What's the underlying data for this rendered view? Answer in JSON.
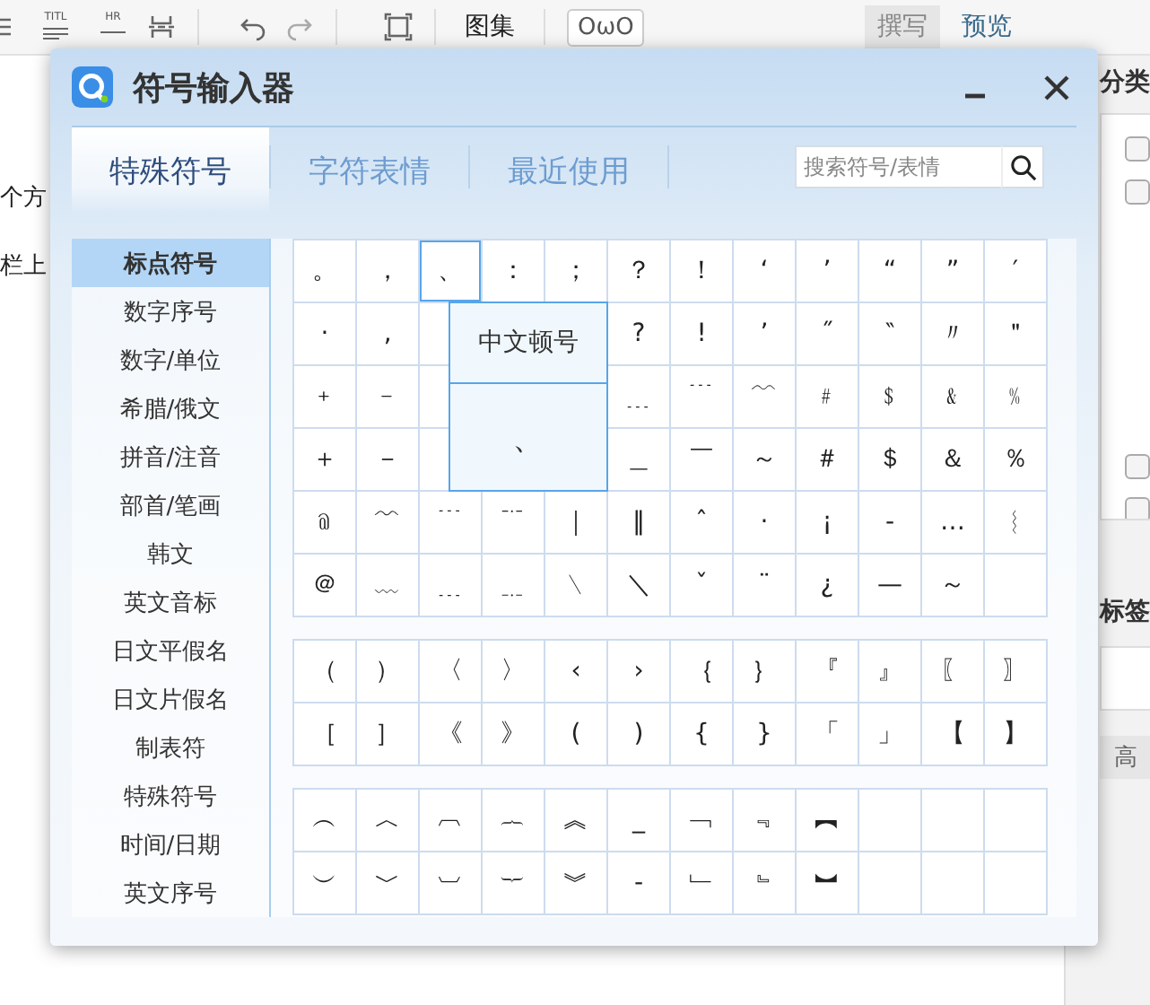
{
  "toolbar": {
    "title_button": "TITL",
    "hr_button": "HR",
    "gallery_button": "图集",
    "emoji_button": "OωO",
    "modes": [
      {
        "label": "撰写",
        "selected": true
      },
      {
        "label": "预览",
        "selected": false
      }
    ]
  },
  "editor": {
    "lines": [
      "个方",
      "栏上"
    ]
  },
  "side_panel": {
    "category_heading": "分类",
    "categories": [
      {
        "checked": false
      },
      {
        "checked": false
      },
      {
        "checked": false
      },
      {
        "checked": false
      }
    ],
    "tags_heading": "标签",
    "advanced": "高"
  },
  "dialog": {
    "title": "符号输入器",
    "tabs": [
      {
        "label": "特殊符号",
        "selected": true
      },
      {
        "label": "字符表情",
        "selected": false
      },
      {
        "label": "最近使用",
        "selected": false
      }
    ],
    "search": {
      "placeholder": "搜索符号/表情"
    },
    "categories": [
      {
        "label": "标点符号",
        "selected": true
      },
      {
        "label": "数字序号",
        "selected": false
      },
      {
        "label": "数字/单位",
        "selected": false
      },
      {
        "label": "希腊/俄文",
        "selected": false
      },
      {
        "label": "拼音/注音",
        "selected": false
      },
      {
        "label": "部首/笔画",
        "selected": false
      },
      {
        "label": "韩文",
        "selected": false
      },
      {
        "label": "英文音标",
        "selected": false
      },
      {
        "label": "日文平假名",
        "selected": false
      },
      {
        "label": "日文片假名",
        "selected": false
      },
      {
        "label": "制表符",
        "selected": false
      },
      {
        "label": "特殊符号",
        "selected": false
      },
      {
        "label": "时间/日期",
        "selected": false
      },
      {
        "label": "英文序号",
        "selected": false
      }
    ],
    "sections": [
      {
        "rows": [
          [
            {
              "kind": "symbol",
              "symbol": "。",
              "selected": false
            },
            {
              "kind": "symbol",
              "symbol": "，",
              "selected": false
            },
            {
              "kind": "symbol",
              "symbol": "、",
              "selected": true
            },
            {
              "kind": "symbol",
              "symbol": "：",
              "selected": false
            },
            {
              "kind": "symbol",
              "symbol": "；",
              "selected": false
            },
            {
              "kind": "symbol",
              "symbol": "？",
              "selected": false
            },
            {
              "kind": "symbol",
              "symbol": "！",
              "selected": false
            },
            {
              "kind": "symbol",
              "symbol": "‘",
              "selected": false
            },
            {
              "kind": "symbol",
              "symbol": "’",
              "selected": false
            },
            {
              "kind": "symbol",
              "symbol": "“",
              "selected": false
            },
            {
              "kind": "symbol",
              "symbol": "”",
              "selected": false
            },
            {
              "kind": "symbol",
              "symbol": "′",
              "selected": false
            }
          ],
          [
            {
              "kind": "symbol",
              "symbol": "·",
              "selected": false
            },
            {
              "kind": "symbol",
              "symbol": "‚",
              "selected": false
            },
            null,
            null,
            null,
            {
              "kind": "symbol",
              "symbol": "?",
              "selected": false
            },
            {
              "kind": "symbol",
              "symbol": "!",
              "selected": false
            },
            {
              "kind": "symbol",
              "symbol": "ʼ",
              "selected": false
            },
            {
              "kind": "symbol",
              "symbol": "˝",
              "selected": false
            },
            {
              "kind": "symbol",
              "symbol": "‶",
              "selected": false
            },
            {
              "kind": "symbol",
              "symbol": "〃",
              "selected": false
            },
            {
              "kind": "symbol",
              "symbol": "＂",
              "selected": false
            }
          ],
          [
            {
              "kind": "symbol",
              "symbol": "﹢",
              "selected": false
            },
            {
              "kind": "symbol",
              "symbol": "﹣",
              "selected": false
            },
            null,
            null,
            null,
            {
              "kind": "symbol",
              "symbol": "﹍",
              "selected": false
            },
            {
              "kind": "symbol",
              "symbol": "﹉",
              "selected": false
            },
            {
              "kind": "symbol",
              "symbol": "﹋",
              "selected": false
            },
            {
              "kind": "symbol",
              "symbol": "﹟",
              "selected": false
            },
            {
              "kind": "symbol",
              "symbol": "﹩",
              "selected": false
            },
            {
              "kind": "symbol",
              "symbol": "﹠",
              "selected": false
            },
            {
              "kind": "symbol",
              "symbol": "﹪",
              "selected": false
            }
          ],
          [
            {
              "kind": "symbol",
              "symbol": "＋",
              "selected": false
            },
            {
              "kind": "symbol",
              "symbol": "－",
              "selected": false
            },
            null,
            null,
            null,
            {
              "kind": "symbol",
              "symbol": "＿",
              "selected": false
            },
            {
              "kind": "symbol",
              "symbol": "￣",
              "selected": false
            },
            {
              "kind": "symbol",
              "symbol": "～",
              "selected": false
            },
            {
              "kind": "symbol",
              "symbol": "＃",
              "selected": false
            },
            {
              "kind": "symbol",
              "symbol": "＄",
              "selected": false
            },
            {
              "kind": "symbol",
              "symbol": "＆",
              "selected": false
            },
            {
              "kind": "symbol",
              "symbol": "％",
              "selected": false
            }
          ],
          [
            {
              "kind": "symbol",
              "symbol": "﹫",
              "selected": false
            },
            {
              "kind": "symbol",
              "symbol": "﹌",
              "selected": false
            },
            {
              "kind": "symbol",
              "symbol": "﹉",
              "selected": false
            },
            {
              "kind": "symbol",
              "symbol": "﹊",
              "selected": false
            },
            {
              "kind": "symbol",
              "symbol": "｜",
              "selected": false
            },
            {
              "kind": "symbol",
              "symbol": "‖",
              "selected": false
            },
            {
              "kind": "symbol",
              "symbol": "ˆ",
              "selected": false
            },
            {
              "kind": "symbol",
              "symbol": "·",
              "selected": false
            },
            {
              "kind": "symbol",
              "symbol": "¡",
              "selected": false
            },
            {
              "kind": "symbol",
              "symbol": "‐",
              "selected": false
            },
            {
              "kind": "symbol",
              "symbol": "…",
              "selected": false
            },
            {
              "kind": "symbol",
              "symbol": "︴",
              "selected": false
            }
          ],
          [
            {
              "kind": "symbol",
              "symbol": "＠",
              "selected": false
            },
            {
              "kind": "symbol",
              "symbol": "﹏",
              "selected": false
            },
            {
              "kind": "symbol",
              "symbol": "﹍",
              "selected": false
            },
            {
              "kind": "symbol",
              "symbol": "﹎",
              "selected": false
            },
            {
              "kind": "symbol",
              "symbol": "﹨",
              "selected": false
            },
            {
              "kind": "symbol",
              "symbol": "＼",
              "selected": false
            },
            {
              "kind": "symbol",
              "symbol": "ˇ",
              "selected": false
            },
            {
              "kind": "symbol",
              "symbol": "¨",
              "selected": false
            },
            {
              "kind": "symbol",
              "symbol": "¿",
              "selected": false
            },
            {
              "kind": "symbol",
              "symbol": "—",
              "selected": false
            },
            {
              "kind": "symbol",
              "symbol": "～",
              "selected": false
            },
            {
              "kind": "empty"
            }
          ]
        ]
      },
      {
        "rows": [
          [
            {
              "kind": "symbol",
              "symbol": "（",
              "selected": false
            },
            {
              "kind": "symbol",
              "symbol": "）",
              "selected": false
            },
            {
              "kind": "symbol",
              "symbol": "〈",
              "selected": false
            },
            {
              "kind": "symbol",
              "symbol": "〉",
              "selected": false
            },
            {
              "kind": "symbol",
              "symbol": "‹",
              "selected": false
            },
            {
              "kind": "symbol",
              "symbol": "›",
              "selected": false
            },
            {
              "kind": "symbol",
              "symbol": "｛",
              "selected": false
            },
            {
              "kind": "symbol",
              "symbol": "｝",
              "selected": false
            },
            {
              "kind": "symbol",
              "symbol": "『",
              "selected": false
            },
            {
              "kind": "symbol",
              "symbol": "』",
              "selected": false
            },
            {
              "kind": "symbol",
              "symbol": "〖",
              "selected": false
            },
            {
              "kind": "symbol",
              "symbol": "〗",
              "selected": false
            }
          ],
          [
            {
              "kind": "symbol",
              "symbol": "［",
              "selected": false
            },
            {
              "kind": "symbol",
              "symbol": "］",
              "selected": false
            },
            {
              "kind": "symbol",
              "symbol": "《",
              "selected": false
            },
            {
              "kind": "symbol",
              "symbol": "》",
              "selected": false
            },
            {
              "kind": "symbol",
              "symbol": "(",
              "selected": false
            },
            {
              "kind": "symbol",
              "symbol": ")",
              "selected": false
            },
            {
              "kind": "symbol",
              "symbol": "{",
              "selected": false
            },
            {
              "kind": "symbol",
              "symbol": "}",
              "selected": false
            },
            {
              "kind": "symbol",
              "symbol": "「",
              "selected": false
            },
            {
              "kind": "symbol",
              "symbol": "」",
              "selected": false
            },
            {
              "kind": "symbol",
              "symbol": "【",
              "selected": false
            },
            {
              "kind": "symbol",
              "symbol": "】",
              "selected": false
            }
          ]
        ]
      },
      {
        "rows": [
          [
            {
              "kind": "symbol",
              "symbol": "︵",
              "selected": false
            },
            {
              "kind": "symbol",
              "symbol": "︿",
              "selected": false
            },
            {
              "kind": "symbol",
              "symbol": "︹",
              "selected": false
            },
            {
              "kind": "symbol",
              "symbol": "︷",
              "selected": false
            },
            {
              "kind": "symbol",
              "symbol": "︽",
              "selected": false
            },
            {
              "kind": "symbol",
              "symbol": "_",
              "selected": false
            },
            {
              "kind": "symbol",
              "symbol": "﹁",
              "selected": false
            },
            {
              "kind": "symbol",
              "symbol": "﹃",
              "selected": false
            },
            {
              "kind": "symbol",
              "symbol": "︻",
              "selected": false
            },
            {
              "kind": "empty"
            },
            {
              "kind": "empty"
            },
            {
              "kind": "empty"
            }
          ],
          [
            {
              "kind": "symbol",
              "symbol": "︶",
              "selected": false
            },
            {
              "kind": "symbol",
              "symbol": "﹀",
              "selected": false
            },
            {
              "kind": "symbol",
              "symbol": "︺",
              "selected": false
            },
            {
              "kind": "symbol",
              "symbol": "︸",
              "selected": false
            },
            {
              "kind": "symbol",
              "symbol": "︾",
              "selected": false
            },
            {
              "kind": "symbol",
              "symbol": "-",
              "selected": false
            },
            {
              "kind": "symbol",
              "symbol": "﹂",
              "selected": false
            },
            {
              "kind": "symbol",
              "symbol": "﹄",
              "selected": false
            },
            {
              "kind": "symbol",
              "symbol": "︼",
              "selected": false
            },
            {
              "kind": "empty"
            },
            {
              "kind": "empty"
            },
            {
              "kind": "empty"
            }
          ]
        ]
      }
    ],
    "tooltip": {
      "title": "中文顿号",
      "symbol": "、"
    }
  }
}
